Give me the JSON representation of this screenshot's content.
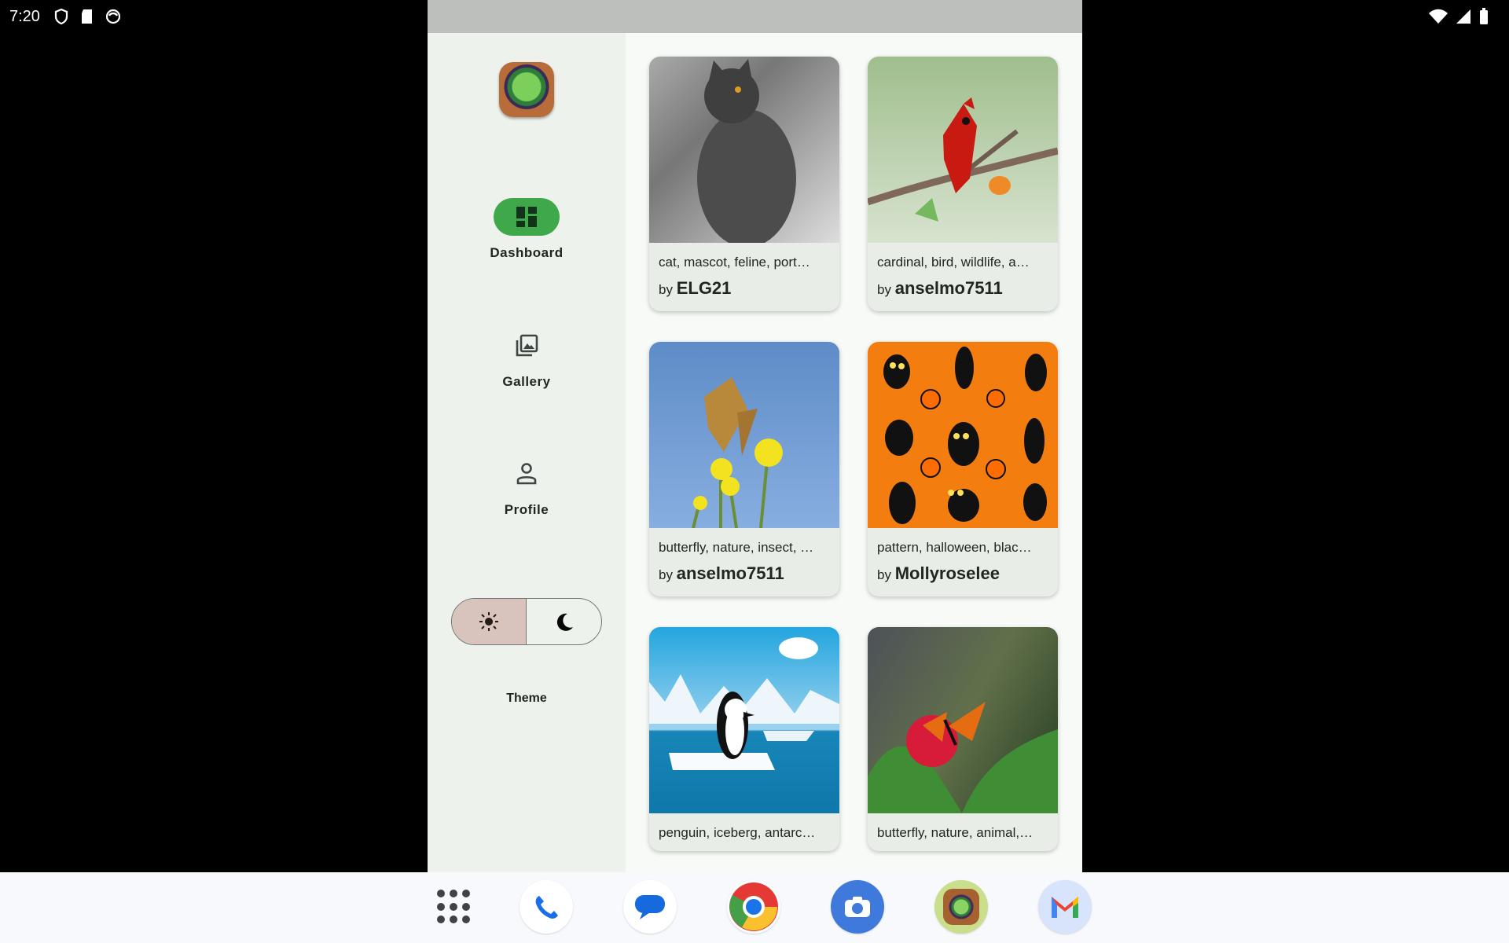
{
  "status_bar": {
    "time": "7:20"
  },
  "navigation": {
    "items": [
      {
        "label": "Dashboard",
        "icon": "dashboard-icon",
        "selected": true
      },
      {
        "label": "Gallery",
        "icon": "gallery-icon",
        "selected": false
      },
      {
        "label": "Profile",
        "icon": "profile-icon",
        "selected": false
      }
    ]
  },
  "theme": {
    "label": "Theme",
    "options": [
      "light-mode-icon",
      "dark-mode-icon"
    ],
    "selected": "light"
  },
  "cards": [
    {
      "tags": "cat, mascot, feline, port…",
      "by": "by",
      "author": "ELG21"
    },
    {
      "tags": "cardinal, bird, wildlife, a…",
      "by": "by",
      "author": "anselmo7511"
    },
    {
      "tags": "butterfly, nature, insect, …",
      "by": "by",
      "author": "anselmo7511"
    },
    {
      "tags": "pattern, halloween, blac…",
      "by": "by",
      "author": "Mollyroselee"
    },
    {
      "tags": "penguin, iceberg, antarc…"
    },
    {
      "tags": "butterfly, nature, animal,…"
    }
  ],
  "dock": [
    "app-drawer-icon",
    "phone-icon",
    "messages-icon",
    "chrome-icon",
    "camera-icon",
    "gallery-app-icon",
    "gmail-icon"
  ],
  "colors": {
    "accent": "#3ea84a",
    "rail": "#eef2ec",
    "window": "#f7faf6"
  }
}
